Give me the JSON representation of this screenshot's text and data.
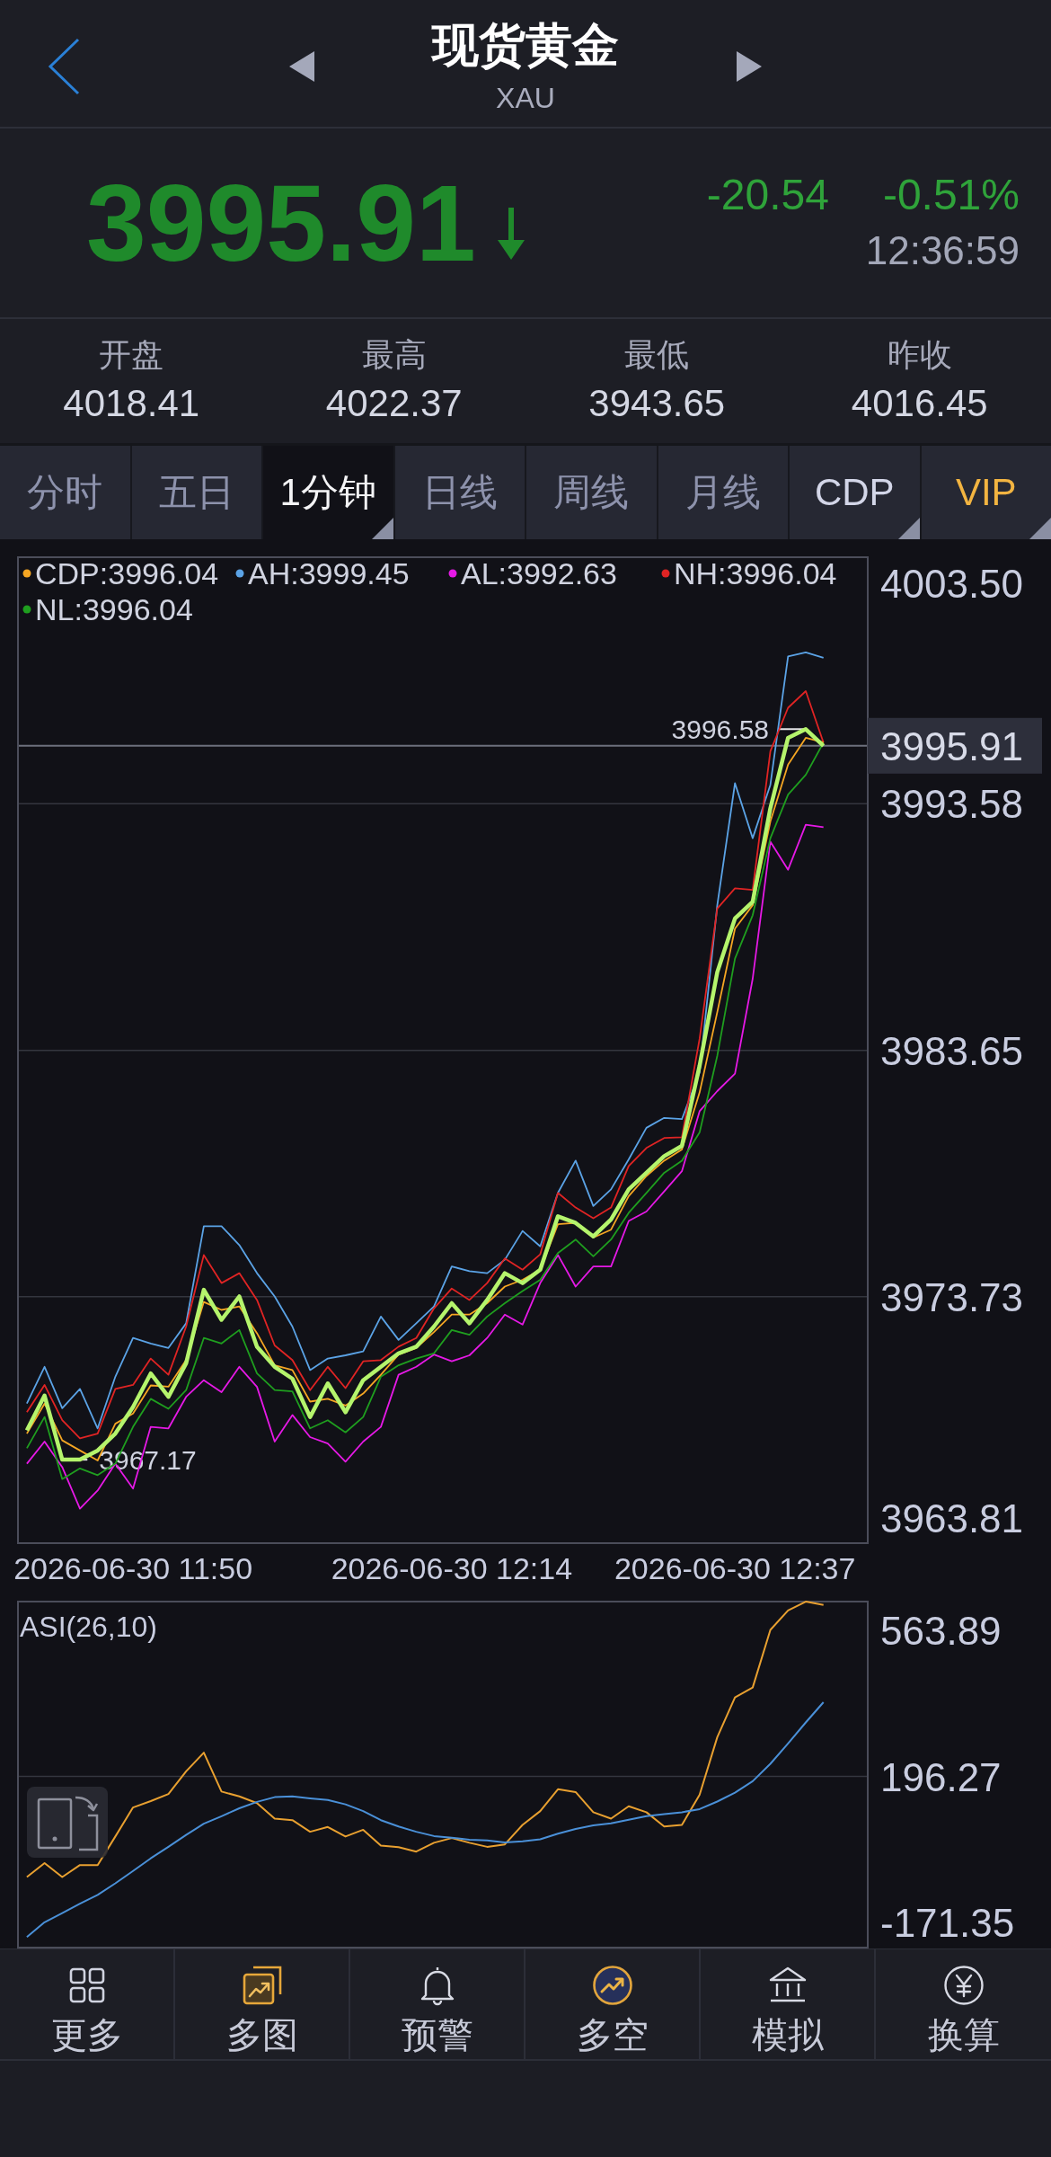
{
  "header": {
    "title": "现货黄金",
    "symbol": "XAU"
  },
  "quote": {
    "price": "3995.91",
    "falling": true,
    "change": "-20.54",
    "change_percent": "-0.51%",
    "time": "12:36:59"
  },
  "stats": [
    {
      "label": "开盘",
      "value": "4018.41"
    },
    {
      "label": "最高",
      "value": "4022.37"
    },
    {
      "label": "最低",
      "value": "3943.65"
    },
    {
      "label": "昨收",
      "value": "4016.45"
    }
  ],
  "tabs": [
    {
      "label": "分时",
      "kind": "period",
      "selected": false,
      "dropdown": false
    },
    {
      "label": "五日",
      "kind": "period",
      "selected": false,
      "dropdown": false
    },
    {
      "label": "1分钟",
      "kind": "period",
      "selected": true,
      "dropdown": true
    },
    {
      "label": "日线",
      "kind": "period",
      "selected": false,
      "dropdown": false
    },
    {
      "label": "周线",
      "kind": "period",
      "selected": false,
      "dropdown": false
    },
    {
      "label": "月线",
      "kind": "period",
      "selected": false,
      "dropdown": false
    },
    {
      "label": "CDP",
      "kind": "indicator",
      "selected": false,
      "dropdown": true
    },
    {
      "label": "VIP",
      "kind": "vip",
      "selected": false,
      "dropdown": true
    }
  ],
  "main_chart": {
    "legend": [
      {
        "text": "CDP:3996.04",
        "color": "#f5a623"
      },
      {
        "text": "AH:3999.45",
        "color": "#5ba3e6"
      },
      {
        "text": "AL:3992.63",
        "color": "#e619e6"
      },
      {
        "text": "NH:3996.04",
        "color": "#e02424"
      },
      {
        "text": "NL:3996.04",
        "color": "#1f9e1f"
      }
    ],
    "chart_data": {
      "type": "line",
      "categories": [
        null,
        null,
        null,
        null,
        null,
        null,
        "2026-06-30 11:50",
        null,
        null,
        null,
        null,
        null,
        null,
        null,
        null,
        null,
        null,
        null,
        null,
        null,
        null,
        null,
        null,
        null,
        "2026-06-30 12:14",
        null,
        null,
        null,
        null,
        null,
        null,
        null,
        null,
        null,
        null,
        null,
        null,
        null,
        null,
        null,
        "2026-06-30 12:37",
        null,
        null,
        null,
        null,
        null
      ],
      "ylim": [
        3963.81,
        4003.5
      ],
      "grid": true,
      "yticks": [
        {
          "value": 4003.5,
          "label": "4003.50"
        },
        {
          "value": 3993.58,
          "label": "3993.58"
        },
        {
          "value": 3983.65,
          "label": "3983.65"
        },
        {
          "value": 3973.73,
          "label": "3973.73"
        },
        {
          "value": 3963.81,
          "label": "3963.81"
        }
      ],
      "series": [
        {
          "color": "#5ba3e6",
          "values": [
            3969.43,
            3970.91,
            3969.24,
            3970.02,
            3968.43,
            3970.51,
            3972.07,
            3971.85,
            3971.67,
            3972.66,
            3976.57,
            3976.57,
            3975.81,
            3974.68,
            3973.74,
            3972.53,
            3970.78,
            3971.24,
            3971.37,
            3971.53,
            3972.93,
            3971.99,
            3972.66,
            3973.34,
            3974.95,
            3974.76,
            3974.68,
            3975.22,
            3976.38,
            3975.76,
            3977.91,
            3979.21,
            3977.38,
            3978.05,
            3979.26,
            3980.53,
            3980.93,
            3980.88,
            3982.76,
            3989.49,
            3994.4,
            3992.19,
            3994.34,
            3999.51,
            3999.67,
            3999.45
          ]
        },
        {
          "color": "#e619e6",
          "values": [
            3967.01,
            3967.9,
            3966.87,
            3965.2,
            3965.93,
            3967.01,
            3966.01,
            3968.49,
            3968.43,
            3969.7,
            3970.37,
            3969.89,
            3970.91,
            3970.1,
            3967.9,
            3968.97,
            3968.08,
            3967.82,
            3967.09,
            3967.9,
            3968.49,
            3970.59,
            3970.91,
            3971.4,
            3971.13,
            3971.37,
            3972.07,
            3973.01,
            3972.61,
            3974.28,
            3975.41,
            3974.14,
            3974.95,
            3974.95,
            3976.78,
            3977.16,
            3977.97,
            3978.78,
            3981.2,
            3982.01,
            3982.71,
            3986.53,
            3992.05,
            3990.92,
            3992.73,
            3992.63
          ]
        },
        {
          "color": "#1f9e1f",
          "values": [
            3967.63,
            3968.89,
            3966.39,
            3966.82,
            3966.55,
            3967.01,
            3968.49,
            3969.62,
            3969.22,
            3969.97,
            3972.07,
            3971.85,
            3972.39,
            3970.64,
            3969.97,
            3969.92,
            3968.43,
            3968.76,
            3968.27,
            3968.89,
            3970.51,
            3970.97,
            3971.24,
            3971.45,
            3972.39,
            3972.2,
            3972.93,
            3973.47,
            3973.96,
            3974.41,
            3975.49,
            3976.03,
            3975.36,
            3976.03,
            3977.11,
            3977.91,
            3978.72,
            3979.21,
            3980.34,
            3983.43,
            3987.34,
            3989.09,
            3992.19,
            3993.94,
            3994.74,
            3996.04
          ]
        },
        {
          "color": "#e02424",
          "values": [
            3969.08,
            3970.18,
            3968.76,
            3968.03,
            3968.22,
            3970.02,
            3970.18,
            3971.24,
            3970.59,
            3972.53,
            3975.41,
            3974.28,
            3974.68,
            3973.6,
            3971.77,
            3971.18,
            3969.97,
            3970.91,
            3970.05,
            3971.13,
            3971.18,
            3971.72,
            3972.07,
            3973.26,
            3974.06,
            3973.6,
            3974.28,
            3975.27,
            3974.82,
            3975.44,
            3977.91,
            3977.32,
            3976.89,
            3977.32,
            3978.99,
            3979.72,
            3980.12,
            3980.15,
            3984.11,
            3989.36,
            3990.17,
            3990.11,
            3995.69,
            3997.44,
            3998.11,
            3996.04
          ]
        },
        {
          "color": "#f5a623",
          "values": [
            3968.22,
            3969.43,
            3967.95,
            3967.54,
            3967.14,
            3968.62,
            3969.03,
            3970.16,
            3970.11,
            3971.18,
            3973.52,
            3973.2,
            3973.34,
            3972.26,
            3970.97,
            3970.78,
            3969.51,
            3969.62,
            3969.35,
            3969.83,
            3970.59,
            3971.4,
            3971.67,
            3972.31,
            3973.01,
            3973.01,
            3973.47,
            3974.14,
            3974.41,
            3974.82,
            3976.65,
            3976.7,
            3976.11,
            3976.43,
            3977.78,
            3978.59,
            3979.21,
            3979.66,
            3981.95,
            3985.19,
            3988.55,
            3989.49,
            3992.86,
            3995.15,
            3996.23,
            3996.04
          ]
        },
        {
          "color": "#b5f46c",
          "values": [
            3968.35,
            3969.75,
            3967.17,
            3967.17,
            3967.54,
            3968.22,
            3969.29,
            3970.64,
            3969.7,
            3971.05,
            3974.01,
            3972.8,
            3973.74,
            3971.72,
            3970.91,
            3970.43,
            3968.89,
            3970.24,
            3969.08,
            3970.37,
            3970.91,
            3971.45,
            3971.72,
            3972.53,
            3973.47,
            3972.66,
            3973.6,
            3974.68,
            3974.28,
            3974.82,
            3976.97,
            3976.7,
            3976.16,
            3976.84,
            3978.05,
            3978.72,
            3979.39,
            3979.8,
            3983.03,
            3986.8,
            3988.96,
            3989.63,
            3993.4,
            3996.23,
            3996.58,
            3995.91
          ]
        }
      ],
      "ref_lines": [
        {
          "axis": "y",
          "value": 3995.91,
          "label": "3995.91"
        }
      ],
      "annotations": [
        "3996.58",
        "3967.17"
      ]
    }
  },
  "asi_chart": {
    "chart_data": {
      "type": "line",
      "title": "ASI(26,10)",
      "categories": [
        null,
        null,
        null,
        null,
        null,
        null,
        null,
        null,
        null,
        null,
        null,
        null,
        null,
        null,
        null,
        null,
        null,
        null,
        null,
        null,
        null,
        null,
        null,
        null,
        null,
        null,
        null,
        null,
        null,
        null,
        null,
        null,
        null,
        null,
        null,
        null,
        null,
        null,
        null,
        null,
        null,
        null,
        null,
        null,
        null,
        null
      ],
      "ylim": [
        -234.69,
        636.28
      ],
      "grid": true,
      "yticks": [
        {
          "value": 563.89,
          "label": "563.89"
        },
        {
          "value": 196.27,
          "label": "196.27"
        },
        {
          "value": -171.35,
          "label": "-171.35"
        }
      ],
      "series": [
        {
          "color": "#e8a030",
          "values": [
            -57,
            -22,
            -57,
            -27,
            -27,
            45,
            118,
            134,
            152,
            209,
            256,
            158,
            146,
            129,
            90,
            86,
            57,
            69,
            45,
            62,
            22,
            18,
            7,
            29,
            41,
            29,
            19,
            25,
            74,
            109,
            164,
            157,
            106,
            90,
            121,
            106,
            70,
            74,
            150,
            295,
            395,
            420,
            565,
            614,
            636,
            628
          ]
        },
        {
          "color": "#4a90d8",
          "values": [
            -208,
            -171,
            -148,
            -124,
            -102,
            -73,
            -42,
            -10,
            19,
            49,
            77,
            96,
            116,
            132,
            144,
            146,
            141,
            137,
            126,
            109,
            86,
            70,
            57,
            46,
            42,
            37,
            35,
            30,
            33,
            38,
            52,
            64,
            73,
            78,
            87,
            96,
            101,
            106,
            114,
            133,
            155,
            184,
            228,
            279,
            332,
            383
          ]
        }
      ]
    }
  },
  "bottom_nav": [
    {
      "label": "更多"
    },
    {
      "label": "多图"
    },
    {
      "label": "预警"
    },
    {
      "label": "多空"
    },
    {
      "label": "模拟"
    },
    {
      "label": "换算"
    }
  ]
}
